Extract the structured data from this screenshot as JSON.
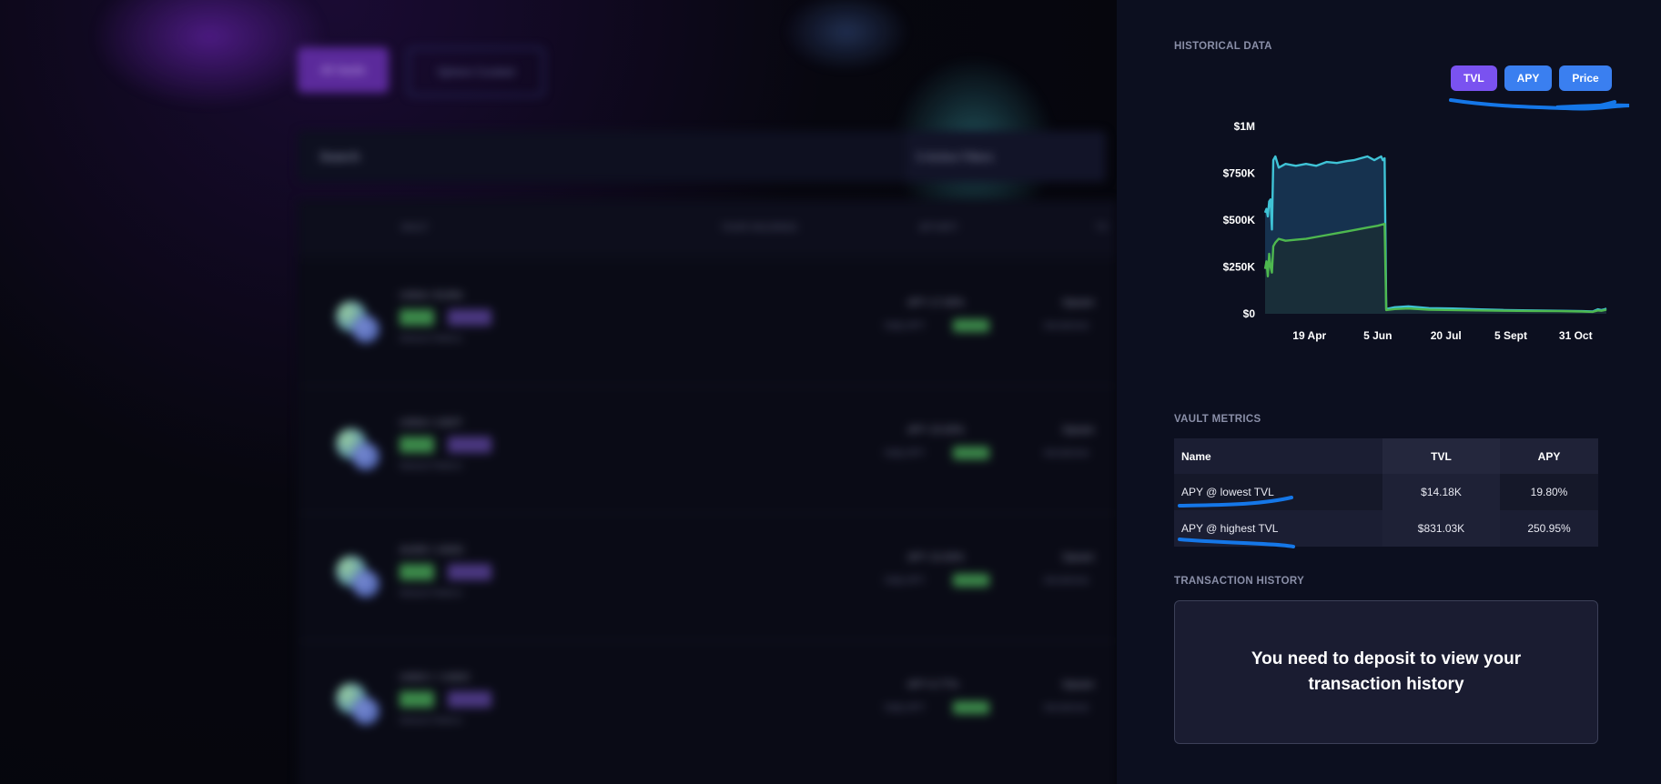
{
  "background": {
    "filter_tabs": [
      "All Vaults",
      "Sphere Curated"
    ],
    "search_placeholder": "Search",
    "filters_label": "5 Active Filters",
    "columns": [
      "VAULT",
      "YOUR HOLDINGS",
      "APY/APY",
      "TV"
    ],
    "rows": [
      {
        "pair": "USDA / EURA",
        "apy": "APY  17.00%",
        "sub": "Daily APY",
        "opt": "Opsam",
        "opt2": "Aerodrome"
      },
      {
        "pair": "USDA / USDT",
        "apy": "APY  15.00%",
        "sub": "Daily APY",
        "opt": "Opsam",
        "opt2": "Aerodrome"
      },
      {
        "pair": "AUDD / USDC",
        "apy": "APY  10.00%",
        "sub": "Daily APY",
        "opt": "Opsam",
        "opt2": "Aerodrome"
      },
      {
        "pair": "USDC+ / USDC",
        "apy": "APY  6.77%",
        "sub": "Daily APY",
        "opt": "Opsam",
        "opt2": "Aerodrome"
      }
    ],
    "net_label": "Network  Platform",
    "net_values": "Base  Aerodrome"
  },
  "panel": {
    "historical_title": "HISTORICAL DATA",
    "tabs": [
      {
        "id": "tvl",
        "label": "TVL",
        "active": true
      },
      {
        "id": "apy",
        "label": "APY",
        "active": false
      },
      {
        "id": "price",
        "label": "Price",
        "active": false
      }
    ],
    "metrics_title": "VAULT METRICS",
    "metrics_headers": {
      "name": "Name",
      "tvl": "TVL",
      "apy": "APY"
    },
    "metrics_rows": [
      {
        "name": "APY @ lowest TVL",
        "tvl": "$14.18K",
        "apy": "19.80%"
      },
      {
        "name": "APY @ highest TVL",
        "tvl": "$831.03K",
        "apy": "250.95%"
      }
    ],
    "tx_title": "TRANSACTION HISTORY",
    "tx_message": "You need to deposit to view your transaction history"
  },
  "chart_data": {
    "type": "area",
    "y_ticks": [
      "$1M",
      "$750K",
      "$500K",
      "$250K",
      "$0"
    ],
    "x_ticks": [
      "19 Apr",
      "5 Jun",
      "20 Jul",
      "5 Sept",
      "31 Oct"
    ],
    "ylim": [
      0,
      1000000
    ],
    "series": [
      {
        "color": "#3fc3d6",
        "fill": "#173552",
        "values": [
          [
            0,
            540000
          ],
          [
            0.004,
            560000
          ],
          [
            0.008,
            520000
          ],
          [
            0.012,
            600000
          ],
          [
            0.016,
            610000
          ],
          [
            0.02,
            450000
          ],
          [
            0.024,
            820000
          ],
          [
            0.03,
            840000
          ],
          [
            0.04,
            780000
          ],
          [
            0.06,
            800000
          ],
          [
            0.09,
            790000
          ],
          [
            0.12,
            800000
          ],
          [
            0.15,
            790000
          ],
          [
            0.18,
            810000
          ],
          [
            0.21,
            805000
          ],
          [
            0.24,
            815000
          ],
          [
            0.26,
            820000
          ],
          [
            0.28,
            830000
          ],
          [
            0.3,
            840000
          ],
          [
            0.32,
            820000
          ],
          [
            0.34,
            840000
          ],
          [
            0.345,
            820000
          ],
          [
            0.35,
            830000
          ],
          [
            0.355,
            25000
          ],
          [
            0.38,
            35000
          ],
          [
            0.42,
            40000
          ],
          [
            0.48,
            30000
          ],
          [
            0.55,
            28000
          ],
          [
            0.62,
            24000
          ],
          [
            0.7,
            20000
          ],
          [
            0.78,
            18000
          ],
          [
            0.86,
            16000
          ],
          [
            0.93,
            14000
          ],
          [
            0.96,
            12000
          ],
          [
            0.975,
            24000
          ],
          [
            0.985,
            20000
          ],
          [
            0.995,
            24000
          ],
          [
            1.0,
            28000
          ]
        ]
      },
      {
        "color": "#4eb84f",
        "fill": "#1a2e36",
        "values": [
          [
            0,
            240000
          ],
          [
            0.004,
            280000
          ],
          [
            0.008,
            200000
          ],
          [
            0.012,
            320000
          ],
          [
            0.016,
            250000
          ],
          [
            0.02,
            220000
          ],
          [
            0.024,
            360000
          ],
          [
            0.03,
            380000
          ],
          [
            0.04,
            400000
          ],
          [
            0.06,
            390000
          ],
          [
            0.09,
            395000
          ],
          [
            0.12,
            400000
          ],
          [
            0.15,
            410000
          ],
          [
            0.18,
            420000
          ],
          [
            0.21,
            430000
          ],
          [
            0.24,
            440000
          ],
          [
            0.27,
            450000
          ],
          [
            0.3,
            460000
          ],
          [
            0.33,
            470000
          ],
          [
            0.35,
            480000
          ],
          [
            0.355,
            20000
          ],
          [
            0.38,
            25000
          ],
          [
            0.42,
            28000
          ],
          [
            0.48,
            22000
          ],
          [
            0.55,
            20000
          ],
          [
            0.62,
            18000
          ],
          [
            0.7,
            16000
          ],
          [
            0.78,
            15000
          ],
          [
            0.86,
            14000
          ],
          [
            0.93,
            12000
          ],
          [
            0.96,
            10000
          ],
          [
            0.975,
            18000
          ],
          [
            0.985,
            16000
          ],
          [
            0.995,
            20000
          ],
          [
            1.0,
            22000
          ]
        ]
      }
    ]
  }
}
